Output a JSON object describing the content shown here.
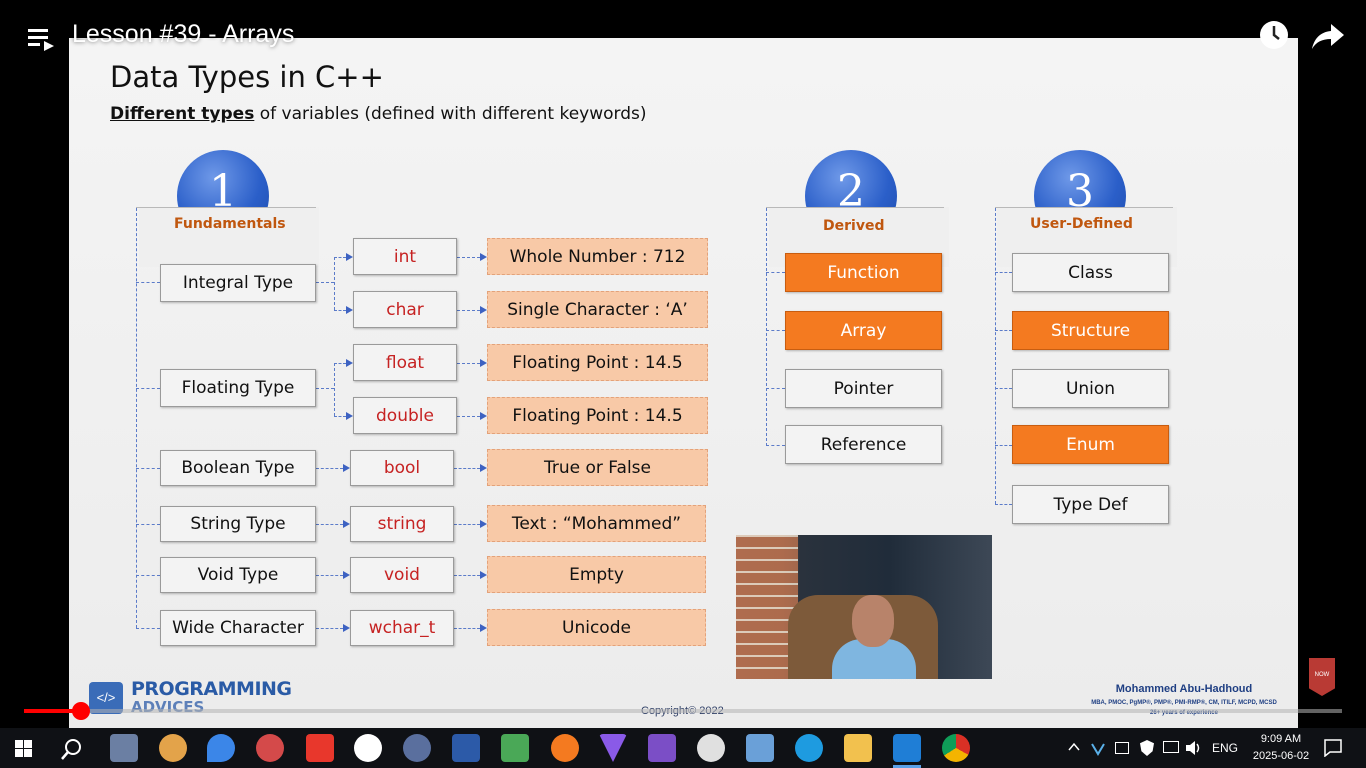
{
  "player": {
    "title": "Lesson #39 - Arrays",
    "progress_fraction": 0.043
  },
  "slide": {
    "title": "Data Types in C++",
    "subtitle_underlined": "Different types",
    "subtitle_rest": " of variables (defined with different keywords)",
    "groups": [
      {
        "number": "1",
        "label": "Fundamentals"
      },
      {
        "number": "2",
        "label": "Derived"
      },
      {
        "number": "3",
        "label": "User-Defined"
      }
    ],
    "fundamentals": [
      {
        "type": "Integral Type",
        "keyword": "int",
        "value": "Whole Number : 712"
      },
      {
        "type": "",
        "keyword": "char",
        "value": "Single Character : ‘A’"
      },
      {
        "type": "Floating Type",
        "keyword": "float",
        "value": "Floating Point : 14.5"
      },
      {
        "type": "",
        "keyword": "double",
        "value": "Floating Point : 14.5"
      },
      {
        "type": "Boolean Type",
        "keyword": "bool",
        "value": "True or False"
      },
      {
        "type": "String Type",
        "keyword": "string",
        "value": "Text : “Mohammed”"
      },
      {
        "type": "Void Type",
        "keyword": "void",
        "value": "Empty"
      },
      {
        "type": "Wide Character",
        "keyword": "wchar_t",
        "value": "Unicode"
      }
    ],
    "derived": [
      "Function",
      "Array",
      "Pointer",
      "Reference"
    ],
    "user_defined": [
      "Class",
      "Structure",
      "Union",
      "Enum",
      "Type Def"
    ],
    "logo_line1": "PROGRAMMING",
    "logo_line2": "ADVICES",
    "copyright": "Copyright© 2022",
    "author": "Mohammed Abu-Hadhoud",
    "author_credentials": "MBA, PMOC, PgMP®, PMP®, PMI-RMP®, CM, ITILF, MCPD, MCSD",
    "author_years": "26+ years of experience",
    "badge": "NOW"
  },
  "colors": {
    "accent_orange": "#f47a20",
    "value_fill": "#f8c9a7",
    "keyword_red": "#c62222",
    "circle_blue": "#2b5fc9",
    "progress_red": "#ff0000"
  },
  "taskbar": {
    "apps": [
      "start-icon",
      "search-icon",
      "calculator-icon",
      "paint-icon",
      "drop-icon",
      "paint-brush-icon",
      "anydesk-icon",
      "prctv-icon",
      "star-icon",
      "powershell-icon",
      "drive-icon",
      "pen-icon",
      "vpn-icon",
      "visual-studio-icon",
      "clock-app-icon",
      "remote-desktop-icon",
      "edge-icon",
      "file-explorer-icon",
      "vscode-icon",
      "chrome-icon"
    ],
    "lang": "ENG",
    "time": "9:09 AM",
    "date": "2025-06-02"
  }
}
